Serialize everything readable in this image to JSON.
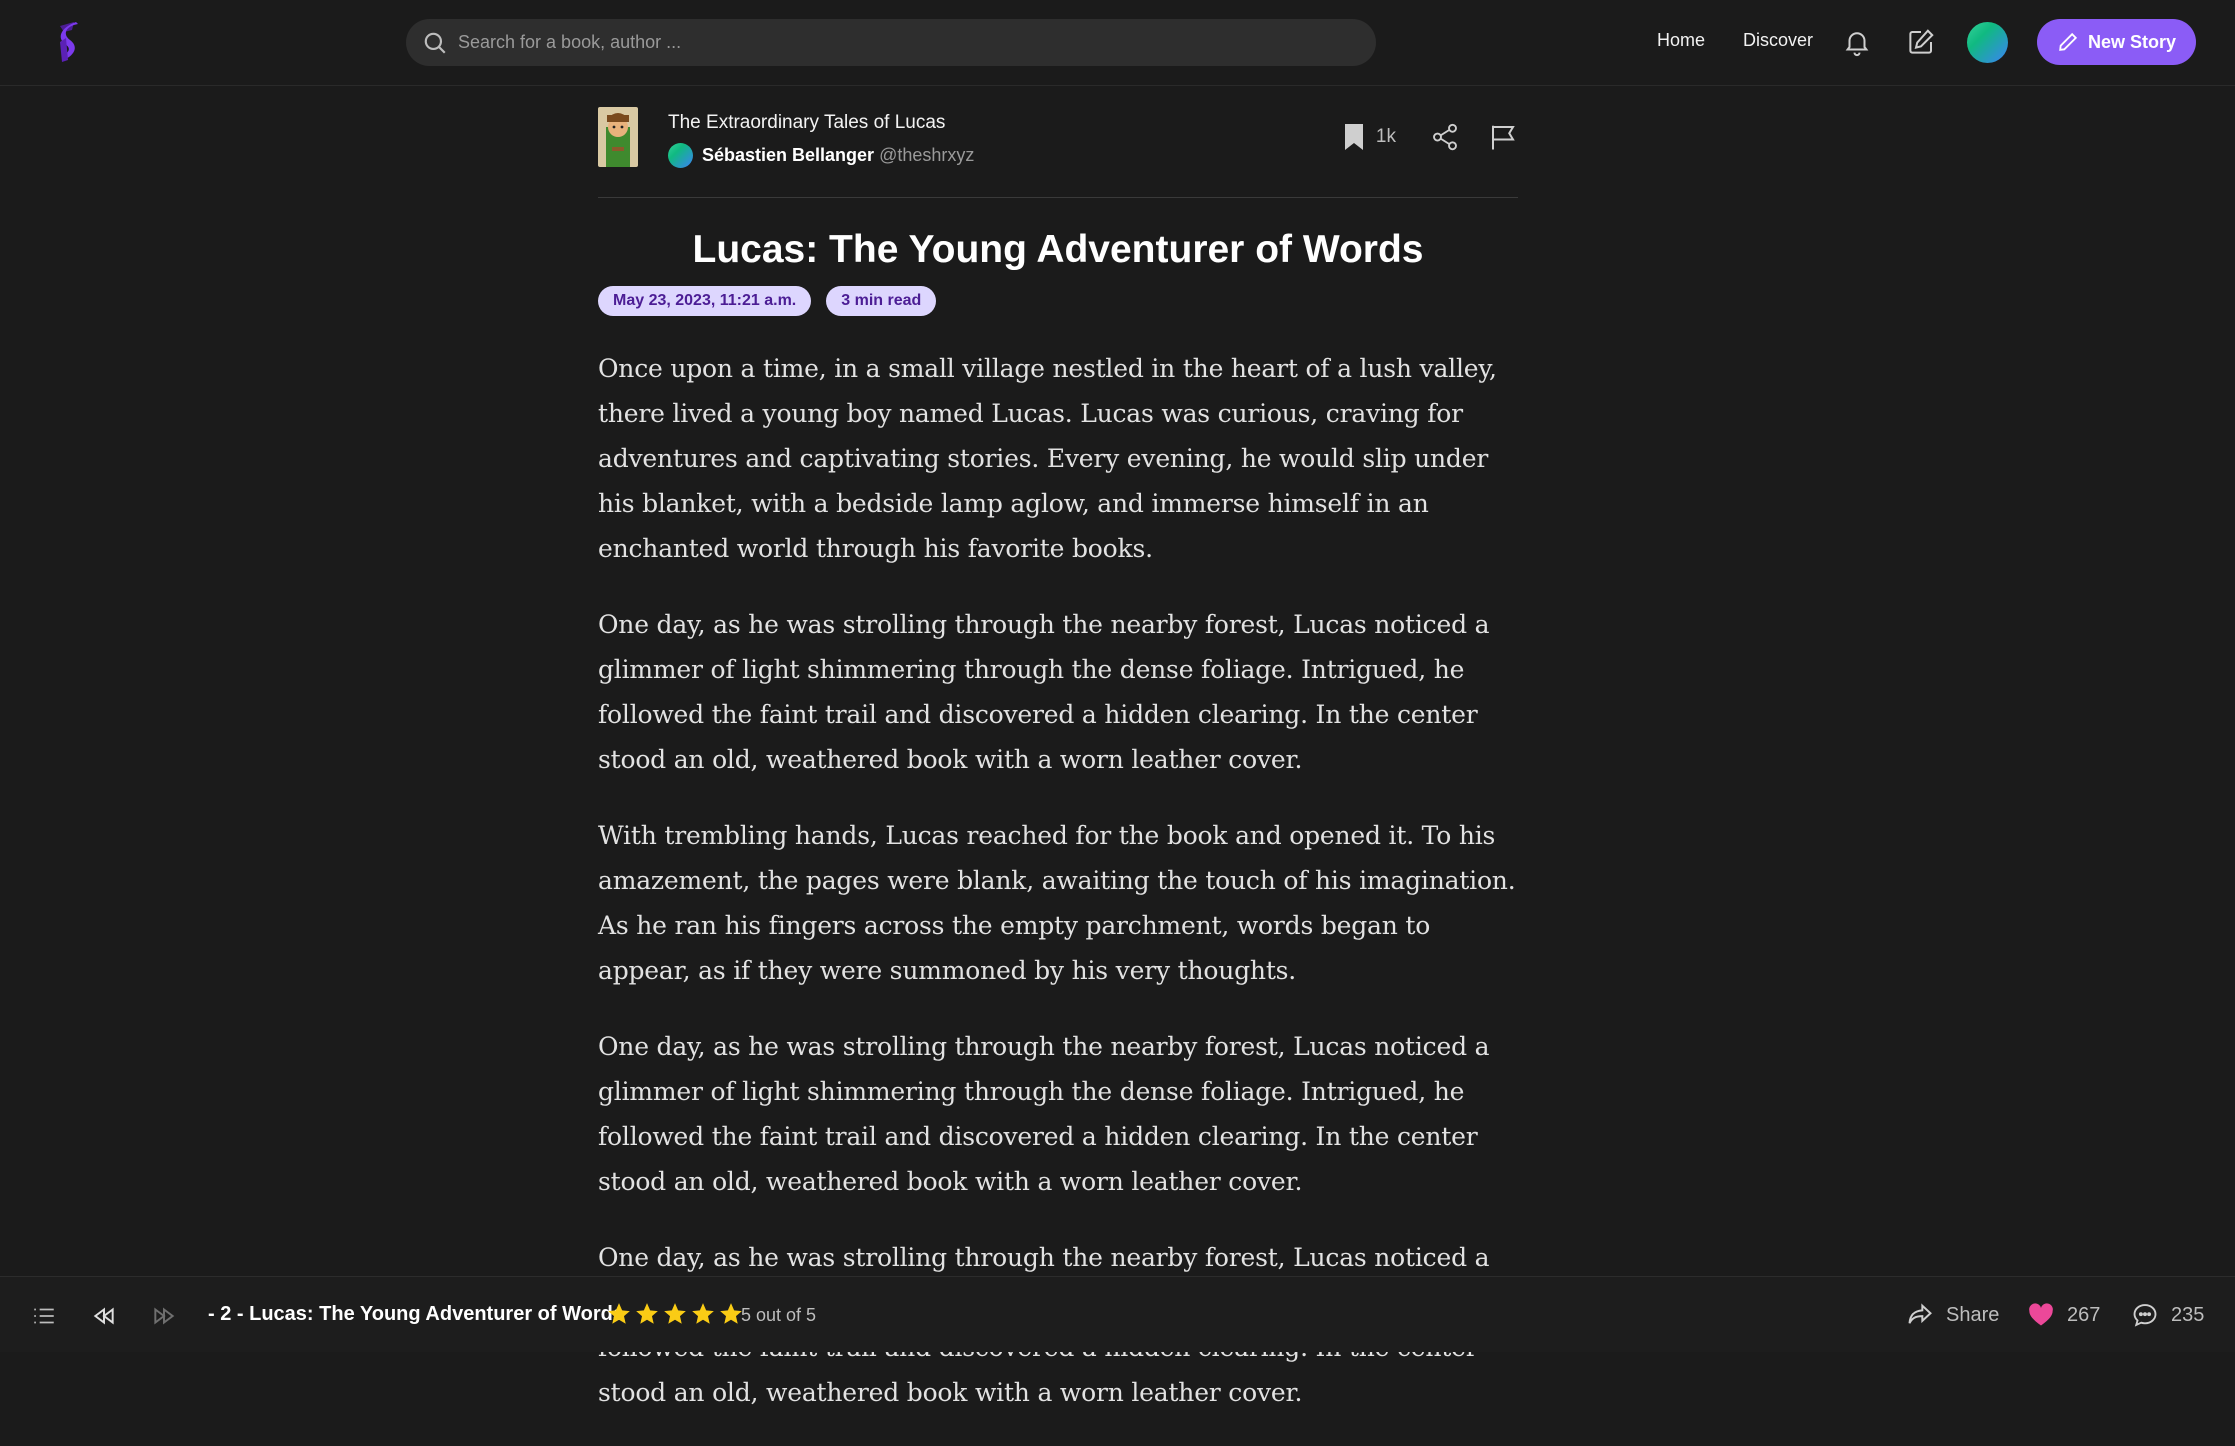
{
  "header": {
    "search_placeholder": "Search for a book, author ...",
    "nav": {
      "home": "Home",
      "discover": "Discover"
    },
    "new_story_label": "New Story",
    "icons": [
      "logo",
      "search-icon",
      "bell-icon",
      "edit-icon",
      "avatar",
      "pencil-icon"
    ]
  },
  "story": {
    "title": "The Extraordinary Tales of Lucas",
    "author_name": "Sébastien Bellanger",
    "author_handle": "@theshrxyz",
    "bookmark_count": "1k"
  },
  "chapter": {
    "title": "Lucas: The Young Adventurer of Words",
    "date": "May 23, 2023, 11:21 a.m.",
    "read_time": "3 min read",
    "paragraphs": [
      "Once upon a time, in a small village nestled in the heart of a lush valley, there lived a young boy named Lucas. Lucas was curious, craving for adventures and captivating stories. Every evening, he would slip under his blanket, with a bedside lamp aglow, and immerse himself in an enchanted world through his favorite books.",
      "One day, as he was strolling through the nearby forest, Lucas noticed a glimmer of light shimmering through the dense foliage. Intrigued, he followed the faint trail and discovered a hidden clearing. In the center stood an old, weathered book with a worn leather cover.",
      "With trembling hands, Lucas reached for the book and opened it. To his amazement, the pages were blank, awaiting the touch of his imagination. As he ran his fingers across the empty parchment, words began to appear, as if they were summoned by his very thoughts.",
      "One day, as he was strolling through the nearby forest, Lucas noticed a glimmer of light shimmering through the dense foliage. Intrigued, he followed the faint trail and discovered a hidden clearing. In the center stood an old, weathered book with a worn leather cover.",
      "One day, as he was strolling through the nearby forest, Lucas noticed a glimmer of light shimmering through the dense foliage. Intrigued, he followed the faint trail and discovered a hidden clearing. In the center stood an old, weathered book with a worn leather cover."
    ]
  },
  "footer": {
    "chapter_label": "- 2 - Lucas: The Young Adventurer of Words",
    "rating": 5,
    "rating_text": "5 out of 5",
    "share_label": "Share",
    "likes": "267",
    "comments": "235"
  },
  "colors": {
    "background": "#1b1b1b",
    "accent": "#8b5cf6",
    "badge_bg": "#ddd6fe",
    "badge_text": "#4c1d95",
    "star": "#facc15",
    "heart": "#ec4899"
  }
}
